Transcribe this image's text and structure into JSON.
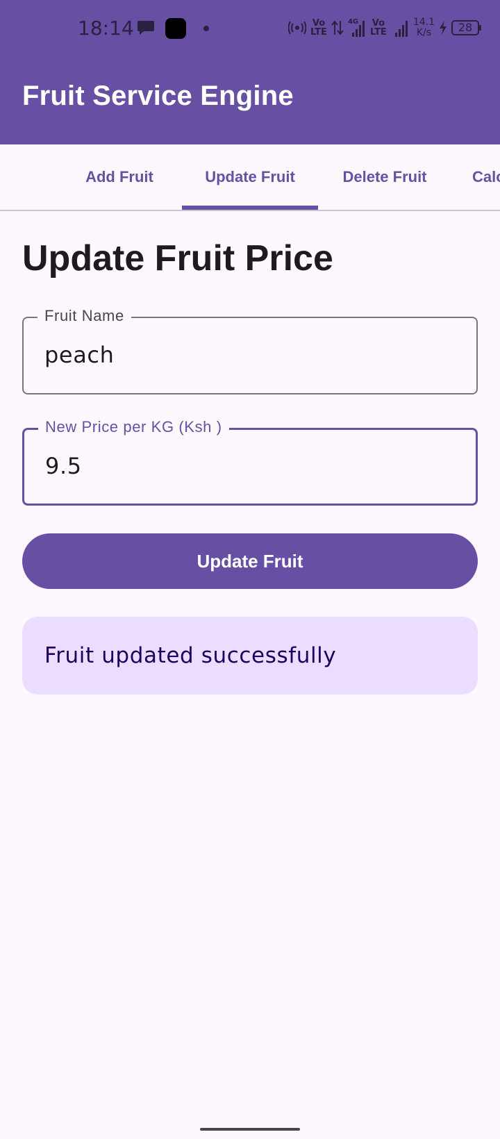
{
  "status_bar": {
    "time": "18:14",
    "volte_1": "Vo\nLTE",
    "network_gen": "4G",
    "volte_2": "Vo\nLTE",
    "speed": "14.1\nK/s",
    "battery": "28"
  },
  "app_bar": {
    "title": "Fruit Service Engine",
    "color": "#6750a4"
  },
  "tabs": [
    {
      "label": "Add Fruit",
      "selected": false
    },
    {
      "label": "Update Fruit",
      "selected": true
    },
    {
      "label": "Delete Fruit",
      "selected": false
    },
    {
      "label": "Calc",
      "selected": false
    }
  ],
  "page": {
    "heading": "Update Fruit Price"
  },
  "form": {
    "name_label": "Fruit Name",
    "name_value": "peach",
    "price_label": "New Price per KG (Ksh )",
    "price_value": "9.5",
    "submit_label": "Update Fruit"
  },
  "result": {
    "message": "Fruit updated successfully"
  }
}
